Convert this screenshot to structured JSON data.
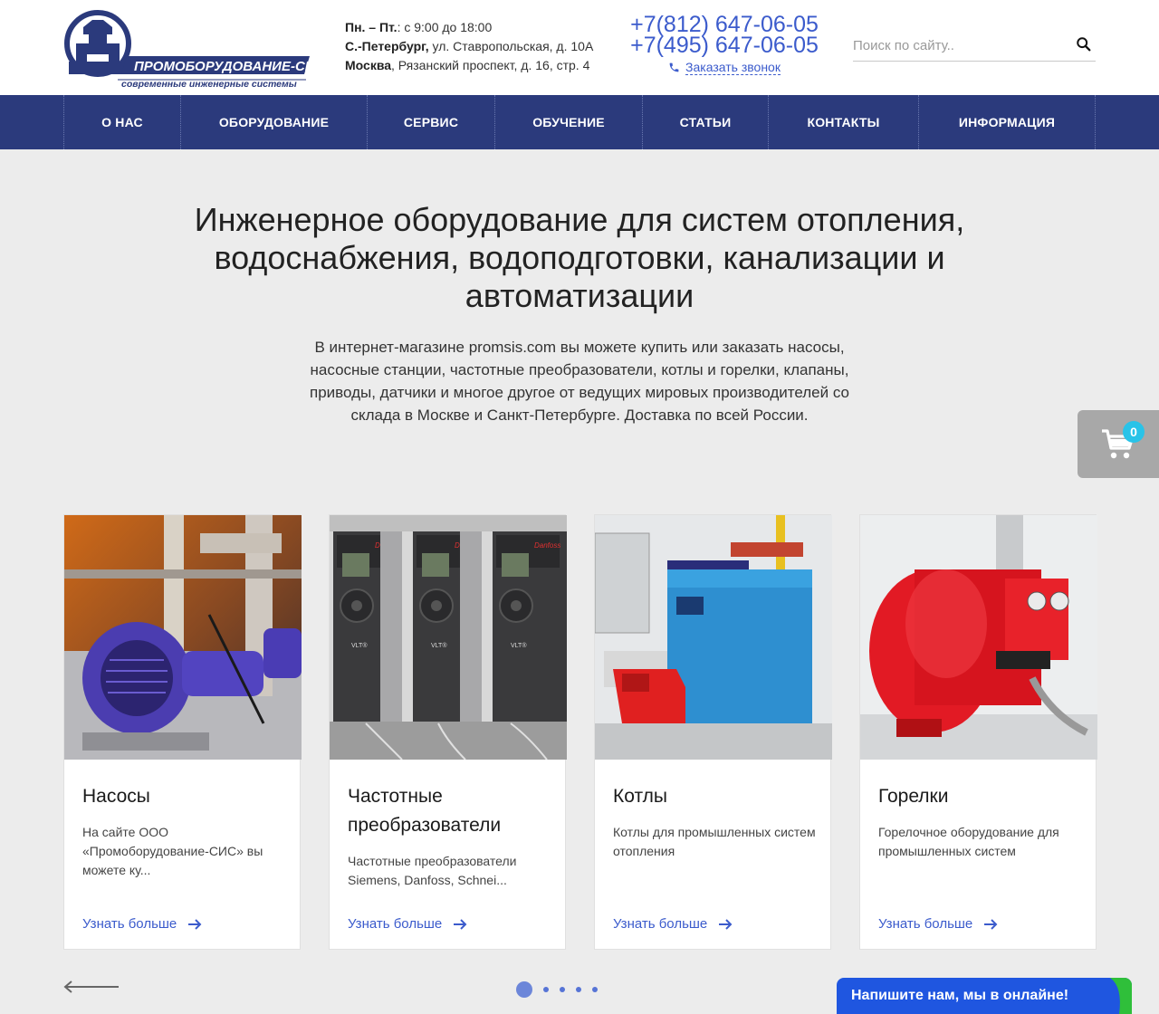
{
  "header": {
    "logo": {
      "brand": "ПРОМОБОРУДОВАНИЕ-СИС",
      "tagline": "современные инженерные системы"
    },
    "contacts": {
      "hours_label": "Пн. – Пт.",
      "hours_value": ": с 9:00 до 18:00",
      "spb_label": "С.-Петербург,",
      "spb_address": " ул. Ставропольская, д. 10А",
      "msk_label": "Москва",
      "msk_address": ", Рязанский проспект, д. 16, стр. 4"
    },
    "phones": [
      "+7(812) 647-06-05",
      "+7(495) 647-06-05"
    ],
    "callback_label": "Заказать звонок",
    "search": {
      "placeholder": "Поиск по сайту.."
    }
  },
  "nav": {
    "items": [
      {
        "label": "О НАС"
      },
      {
        "label": "ОБОРУДОВАНИЕ"
      },
      {
        "label": "СЕРВИС"
      },
      {
        "label": "ОБУЧЕНИЕ"
      },
      {
        "label": "СТАТЬИ"
      },
      {
        "label": "КОНТАКТЫ"
      },
      {
        "label": "ИНФОРМАЦИЯ"
      }
    ]
  },
  "hero": {
    "title": "Инженерное оборудование для систем отопления, водоснабжения, водоподготовки, канализации и автоматизации",
    "text": "В интернет-магазине promsis.com вы можете купить или заказать насосы, насосные станции, частотные преобразователи, котлы и горелки, клапаны, приводы, датчики и многое другое от ведущих мировых производителей со склада в Москве и Санкт-Петербурге. Доставка по всей России."
  },
  "cart": {
    "count": "0"
  },
  "cards": [
    {
      "title": "Насосы",
      "desc": "На сайте ООО «Промоборудование-СИС» вы можете ку...",
      "link": "Узнать больше"
    },
    {
      "title": "Частотные преобразователи",
      "desc": "Частотные преобразователи Siemens, Danfoss, Schnei...",
      "link": "Узнать больше",
      "panel_brand": "Danfoss",
      "panel_label": "VLT®"
    },
    {
      "title": "Котлы",
      "desc": "Котлы для промышленных систем отопления",
      "link": "Узнать больше"
    },
    {
      "title": "Горелки",
      "desc": "Горелочное оборудование для промышленных систем",
      "link": "Узнать больше"
    }
  ],
  "slider": {
    "pages": 5,
    "active": 1
  },
  "chat": {
    "label": "Напишите нам, мы в онлайне!"
  },
  "colors": {
    "primary": "#2b3a7c",
    "accent": "#3b5bcc",
    "cart_badge": "#29c3e8",
    "chat": "#1f56e0"
  },
  "icons": [
    "search-icon",
    "phone-icon",
    "cart-icon",
    "arrow-right-icon",
    "arrow-left-icon"
  ]
}
